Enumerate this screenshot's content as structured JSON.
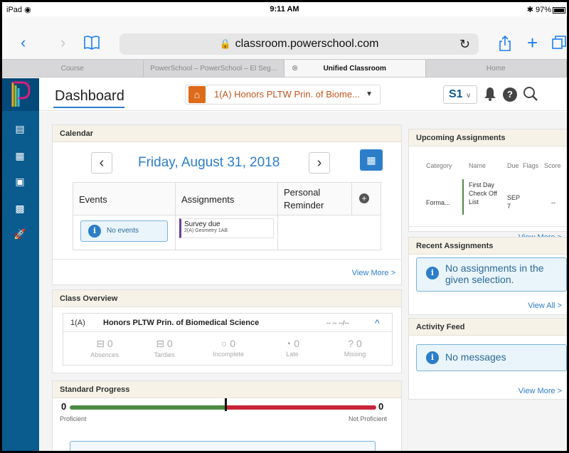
{
  "status_bar": {
    "device": "iPad",
    "wifi": "◉",
    "time": "9:11 AM",
    "bluetooth": "✱",
    "battery": "97%"
  },
  "browser": {
    "url": "classroom.powerschool.com",
    "tabs": [
      {
        "label": "Course",
        "active": false
      },
      {
        "label": "PowerSchool – PowerSchool – El Seg...",
        "active": false
      },
      {
        "label": "Unified Classroom",
        "active": true
      },
      {
        "label": "Home",
        "active": false
      }
    ]
  },
  "header": {
    "title": "Dashboard",
    "class_selector": "1(A) Honors PLTW Prin. of Biome...",
    "term": "S1"
  },
  "calendar": {
    "title": "Calendar",
    "date": "Friday, August 31, 2018",
    "col_events": "Events",
    "col_assignments": "Assignments",
    "col_personal": "Personal Reminder",
    "no_events": "No events",
    "assignment_title": "Survey due",
    "assignment_class": "2(A) Geometry 1AB",
    "view_more": "View More >"
  },
  "class_overview": {
    "title": "Class Overview",
    "period": "1(A)",
    "class_name": "Honors PLTW Prin. of Biomedical Science",
    "grade": "-- -- --/--",
    "stats": [
      {
        "icon": "desk-icon",
        "value": "0",
        "label": "Absences"
      },
      {
        "icon": "desk-icon",
        "value": "0",
        "label": "Tardies"
      },
      {
        "icon": "circle-icon",
        "value": "0",
        "label": "Incomplete"
      },
      {
        "icon": "clock-icon",
        "value": "0",
        "label": "Late"
      },
      {
        "icon": "question-icon",
        "value": "0",
        "label": "Missing"
      }
    ]
  },
  "standard_progress": {
    "title": "Standard Progress",
    "proficient_count": "0",
    "not_proficient_count": "0",
    "proficient_label": "Proficient",
    "not_proficient_label": "Not Proficient"
  },
  "upcoming": {
    "title": "Upcoming Assignments",
    "cols": {
      "category": "Category",
      "name": "Name",
      "due": "Due",
      "flags": "Flags",
      "score": "Score"
    },
    "row": {
      "category": "Forma...",
      "name": "First Day Check Off List",
      "due": "SEP 7",
      "score": "--"
    },
    "view_more": "View More >"
  },
  "recent": {
    "title": "Recent Assignments",
    "message": "No assignments in the given selection.",
    "view_all": "View All >"
  },
  "activity": {
    "title": "Activity Feed",
    "message": "No messages",
    "view_more": "View More >"
  },
  "colors": {
    "rail": "#0a5b8e",
    "accent": "#2c7ec9",
    "proficient": "#4d8b45",
    "not_proficient": "#c9243a",
    "class_orange": "#de6b1b"
  }
}
